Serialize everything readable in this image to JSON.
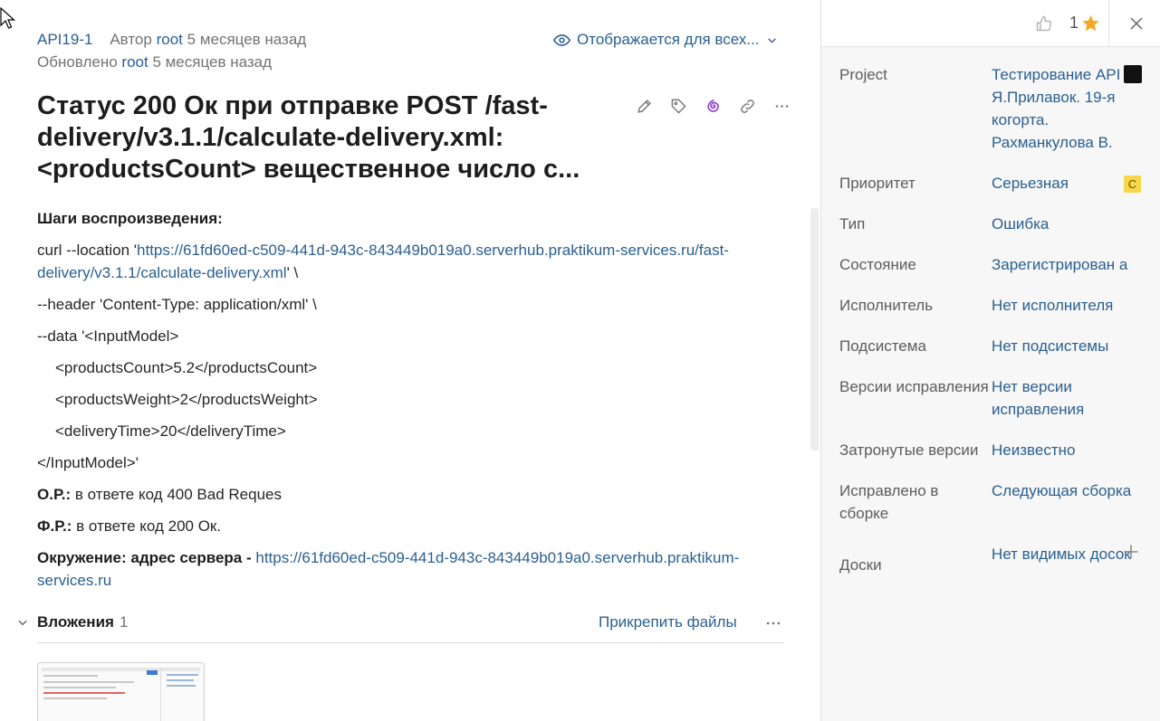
{
  "issue": {
    "key": "API19-1",
    "author_prefix": "Автор",
    "author": "root",
    "created": "5 месяцев назад",
    "updated_prefix": "Обновлено",
    "updater": "root",
    "updated": "5 месяцев назад",
    "visibility": "Отображается для всех...",
    "title": "Статус 200 Ок при отправке POST /fast-delivery/v3.1.1/calculate-delivery.xml: <productsCount> вещественное число с..."
  },
  "body": {
    "steps_label": "Шаги воспроизведения:",
    "curl_prefix": "curl --location '",
    "curl_url": "https://61fd60ed-c509-441d-943c-843449b019a0.serverhub.praktikum-services.ru/fast-delivery/v3.1.1/calculate-delivery.xml",
    "curl_suffix": "' \\",
    "header_line": "--header 'Content-Type: application/xml' \\",
    "data_line": "--data '<InputModel>",
    "xml_line1": "<productsCount>5.2</productsCount>",
    "xml_line2": "<productsWeight>2</productsWeight>",
    "xml_line3": "<deliveryTime>20</deliveryTime>",
    "xml_close": "</InputModel>'",
    "expected_label": "О.Р.:",
    "expected_text": " в ответе код 400 Bad Reques",
    "actual_label": "Ф.Р.:",
    "actual_text": " в ответе код 200 Ок.",
    "env_label": "Окружение: адрес сервера - ",
    "env_url": "https://61fd60ed-c509-441d-943c-843449b019a0.serverhub.praktikum-services.ru"
  },
  "attachments": {
    "label": "Вложения",
    "count": "1",
    "attach_button": "Прикрепить файлы"
  },
  "sidebar": {
    "votes": "1",
    "fields": [
      {
        "key": "Project",
        "value": "Тестирование API Я.Прилавок. 19-я когорта. Рахманкулова В."
      },
      {
        "key": "Приоритет",
        "value": "Серьезная",
        "badge": "С"
      },
      {
        "key": "Тип",
        "value": "Ошибка"
      },
      {
        "key": "Состояние",
        "value": "Зарегистрирован а"
      },
      {
        "key": "Исполнитель",
        "value": "Нет исполнителя"
      },
      {
        "key": "Подсистема",
        "value": "Нет подсистемы"
      },
      {
        "key": "Версии исправления",
        "value": "Нет версии исправления"
      },
      {
        "key": "Затронутые версии",
        "value": "Неизвестно"
      },
      {
        "key": "Исправлено в сборке",
        "value": "Следующая сборка"
      },
      {
        "key": "Доски",
        "value": "Нет видимых досок"
      }
    ]
  },
  "colors": {
    "link": "#2a5f91",
    "star": "#f5a623",
    "ai_icon": "#8a3fd1",
    "priority_badge": "#f6d84a"
  }
}
